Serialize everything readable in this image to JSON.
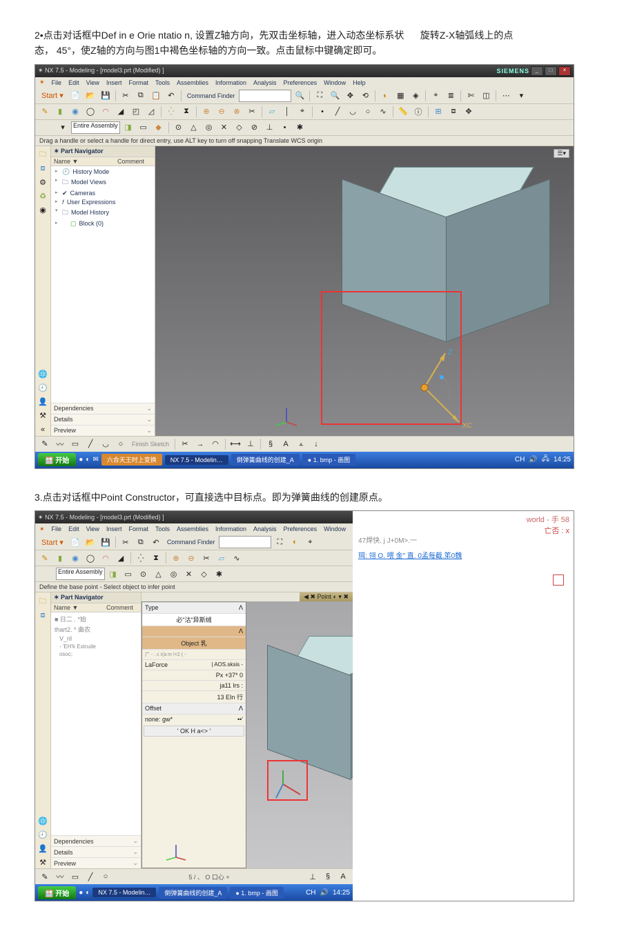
{
  "paragraphs": {
    "p2a": "2•点击对话框中Def in e Orie ntatio n, 设置Z轴方向，先双击坐标轴，进入动态坐标系状",
    "p2b": "旋转Z-X轴弧线上的点",
    "p2c": "态，  45°，使Z轴的方向与图1中褐色坐标轴的方向一致。点击鼠标中键确定即可。",
    "p3": "3.点击对话框中Point Constructor，可直接选中目标点。即为弹簧曲线的创建原点。"
  },
  "app": {
    "title_prefix": "NX 7.5 - Modeling - [model3.prt (Modified) ]",
    "brand": "SIEMENS",
    "menus": [
      "File",
      "Edit",
      "View",
      "Insert",
      "Format",
      "Tools",
      "Assemblies",
      "Information",
      "Analysis",
      "Preferences",
      "Window",
      "Help"
    ],
    "cmdFinderLabel": "Command Finder",
    "assemblyDropdown": "Entire Assembly",
    "status1": "Drag a handle or select a handle for direct entry, use ALT key to turn off snapping Translate WCS origin",
    "status2": "Define the base point - Select object to infer point",
    "nav": {
      "title": "Part Navigator",
      "col1": "Name  ▼",
      "col2": "Comment",
      "items": [
        "History Mode",
        "Model Views",
        "Cameras",
        "User Expressions",
        "Model History"
      ],
      "child": "Block (0)",
      "sections": [
        "Dependencies",
        "Details",
        "Preview"
      ]
    },
    "axis_labels": {
      "x": "XC",
      "z": "Z"
    },
    "pointDlg": {
      "title": "Point",
      "type_label": "Type",
      "type_value": "必\"沽\"异斯绒",
      "obj": "Object 乳",
      "coord_label": "LaForce",
      "coord_sub": "| AOS.sksis -",
      "px": "Px  +37* 0",
      "py": "ja11 lrs :",
      "pz": "13 EIn 行",
      "offset": "Offset",
      "none": "none: gw*",
      "ok": "' OK H a<> '"
    },
    "side_annot": {
      "pg": "world - 手 58",
      "right": "亡否 : x",
      "line1": "47焊快. j J+0M>.一",
      "line2": "珥: 翎 O. 喂 金\" 直. 0孟每截.笫0魏"
    },
    "tree2": {
      "a": "■ 日二 . *始",
      "b": "thart2. * 曲农",
      "c": "V_ril",
      "d": "- 'EH'k Extrude",
      "e": "osoc;"
    },
    "taskbar": {
      "start": "开始",
      "items": [
        "六合天王时上变换",
        "NX 7.5 - Modelin…",
        "倒弹簧曲线的创建_A",
        "● 1. bmp - 画图"
      ],
      "time": "14:25"
    },
    "bottom_ops": "5 / 、 O            口心 +"
  },
  "toolbar_icon_names": [
    "new-icon",
    "open-icon",
    "save-icon",
    "copy-icon",
    "paste-icon",
    "undo-icon",
    "redo-icon",
    "sketch-icon",
    "extrude-icon",
    "hole-icon",
    "blend-icon",
    "chamfer-icon",
    "shell-icon",
    "pattern-icon",
    "mirror-icon",
    "unite-icon",
    "subtract-icon",
    "intersect-icon",
    "trim-icon",
    "datum-icon",
    "curve-icon",
    "point-icon",
    "line-icon",
    "arc-icon",
    "circle-icon",
    "spline-icon"
  ]
}
